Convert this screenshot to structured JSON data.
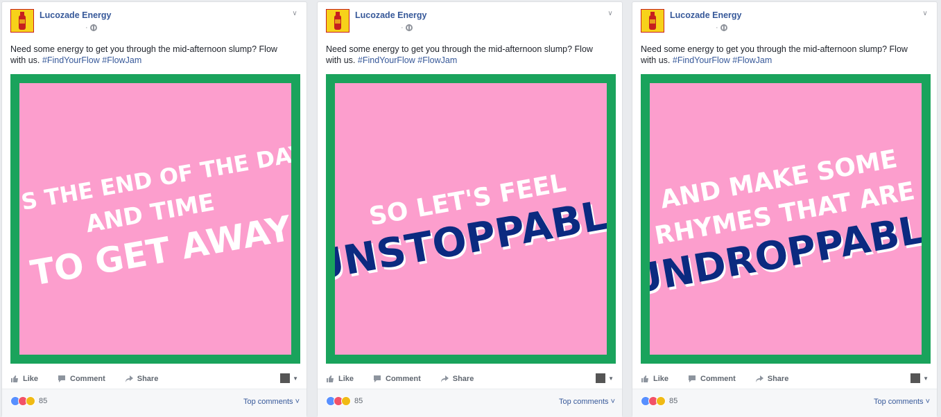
{
  "posts": [
    {
      "page_name": "Lucozade Energy",
      "meta_dot": "·",
      "text": "Need some energy to get you through the mid-afternoon slump? Flow with us.",
      "hashtags": [
        "#FindYourFlow",
        "#FlowJam"
      ],
      "image_lines": [
        "IT'S THE END OF THE DAY",
        "AND TIME",
        "TO GET AWAY"
      ],
      "actions": {
        "like": "Like",
        "comment": "Comment",
        "share": "Share"
      },
      "reaction_count": "85",
      "top_comments": "Top comments ˅"
    },
    {
      "page_name": "Lucozade Energy",
      "meta_dot": "·",
      "text": "Need some energy to get you through the mid-afternoon slump? Flow with us.",
      "hashtags": [
        "#FindYourFlow",
        "#FlowJam"
      ],
      "image_lines": [
        "SO LET'S FEEL",
        "UNSTOPPABLE"
      ],
      "actions": {
        "like": "Like",
        "comment": "Comment",
        "share": "Share"
      },
      "reaction_count": "85",
      "top_comments": "Top comments ˅"
    },
    {
      "page_name": "Lucozade Energy",
      "meta_dot": "·",
      "text": "Need some energy to get you through the mid-afternoon slump? Flow with us.",
      "hashtags": [
        "#FindYourFlow",
        "#FlowJam"
      ],
      "image_lines": [
        "AND MAKE SOME",
        "RHYMES THAT ARE",
        "UNDROPPABLE"
      ],
      "actions": {
        "like": "Like",
        "comment": "Comment",
        "share": "Share"
      },
      "reaction_count": "85",
      "top_comments": "Top comments ˅"
    }
  ],
  "colors": {
    "frame_green": "#1aa35c",
    "image_pink": "#fc9ecd",
    "headline_white": "#ffffff",
    "headline_navy": "#0b2a80",
    "link_blue": "#365899"
  },
  "icons": [
    "lucozade-bottle-icon",
    "globe-icon",
    "chevron-down-icon",
    "like-icon",
    "comment-icon",
    "share-icon",
    "like-reaction-icon",
    "love-reaction-icon",
    "haha-reaction-icon"
  ]
}
